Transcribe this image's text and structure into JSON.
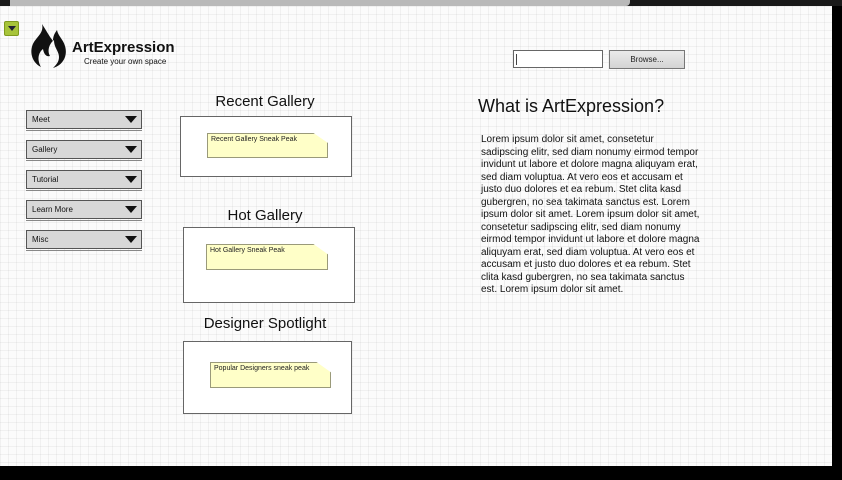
{
  "app": {
    "brand": "ArtExpression",
    "tagline": "Create your own space"
  },
  "upload": {
    "file_value": "",
    "browse_label": "Browse..."
  },
  "sidebar": {
    "items": [
      {
        "label": "Meet"
      },
      {
        "label": "Gallery"
      },
      {
        "label": "Tutorial"
      },
      {
        "label": "Learn More"
      },
      {
        "label": "Misc"
      }
    ]
  },
  "sections": [
    {
      "title": "Recent Gallery",
      "note": "Recent Gallery Sneak Peak"
    },
    {
      "title": "Hot Gallery",
      "note": "Hot Gallery Sneak Peak"
    },
    {
      "title": "Designer Spotlight",
      "note": "Popular Designers sneak peak"
    }
  ],
  "about": {
    "title": "What is ArtExpression?",
    "body": "Lorem ipsum dolor sit amet, consetetur sadipscing elitr, sed diam nonumy eirmod tempor invidunt ut labore et dolore magna aliquyam erat, sed diam voluptua. At vero eos et accusam et justo duo dolores et ea rebum. Stet clita kasd gubergren, no sea takimata sanctus est. Lorem ipsum dolor sit amet. Lorem ipsum dolor sit amet, consetetur sadipscing elitr, sed diam nonumy eirmod tempor invidunt ut labore et dolore magna aliquyam erat, sed diam voluptua. At vero eos et accusam et justo duo dolores et ea rebum. Stet clita kasd gubergren, no sea takimata sanctus est. Lorem ipsum dolor sit amet."
  },
  "icons": {
    "logo": "flame-logo-icon",
    "toggle": "collapse-toggle-icon",
    "dropdown": "chevron-down-icon"
  },
  "colors": {
    "toggle": "#a7c43a",
    "note": "#ffffc8",
    "menu": "#d8d8d8"
  }
}
